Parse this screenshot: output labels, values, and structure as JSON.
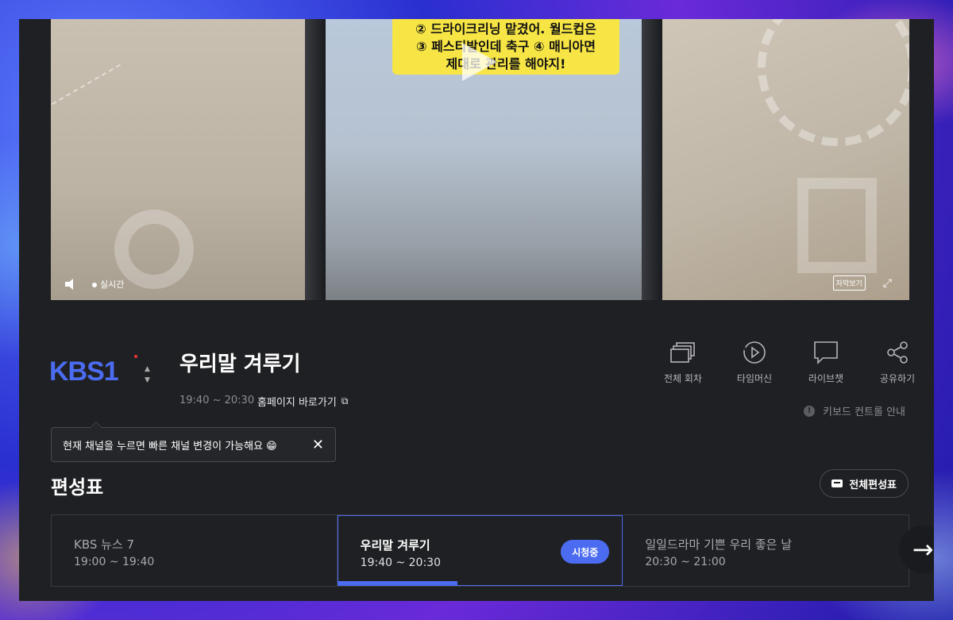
{
  "video": {
    "caption_line1": "② 드라이크리닝 맡겼어. 월드컵은",
    "caption_line2": "③ 페스티발인데 축구 ④ 매니아면",
    "caption_line3": "제대로 관리를 해야지!",
    "live_label": "실시간",
    "subtitle_button": "자막보기",
    "icons": [
      "volume-icon",
      "play-icon",
      "fullscreen-icon"
    ]
  },
  "channel": {
    "logo_text": "KBS1",
    "icons": [
      "channel-up-icon",
      "channel-down-icon"
    ]
  },
  "program": {
    "title": "우리말 겨루기",
    "time": "19:40 ~ 20:30",
    "homepage_link": "홈페이지 바로가기"
  },
  "actions": [
    {
      "label": "전체 회차",
      "icon": "episodes-icon"
    },
    {
      "label": "타임머신",
      "icon": "timemachine-icon"
    },
    {
      "label": "라이브챗",
      "icon": "chat-icon"
    },
    {
      "label": "공유하기",
      "icon": "share-icon"
    }
  ],
  "keyboard_guide": "키보드 컨트롤 안내",
  "tooltip": {
    "text": "현재 채널을 누르면 빠른 채널 변경이 가능해요 😁"
  },
  "schedule": {
    "title": "편성표",
    "full_button": "전체편성표",
    "items": [
      {
        "title": "KBS 뉴스 7",
        "time": "19:00 ~ 19:40"
      },
      {
        "title": "우리말 겨루기",
        "time": "19:40 ~ 20:30",
        "badge": "시청중",
        "progress_fraction": 0.42
      },
      {
        "title": "일일드라마 기쁜 우리 좋은 날",
        "time": "20:30 ~ 21:00"
      }
    ]
  },
  "colors": {
    "accent": "#4b6cf0",
    "background": "#1f2023",
    "caption_bg": "#f7e545",
    "caption_red": "#d8261d"
  }
}
